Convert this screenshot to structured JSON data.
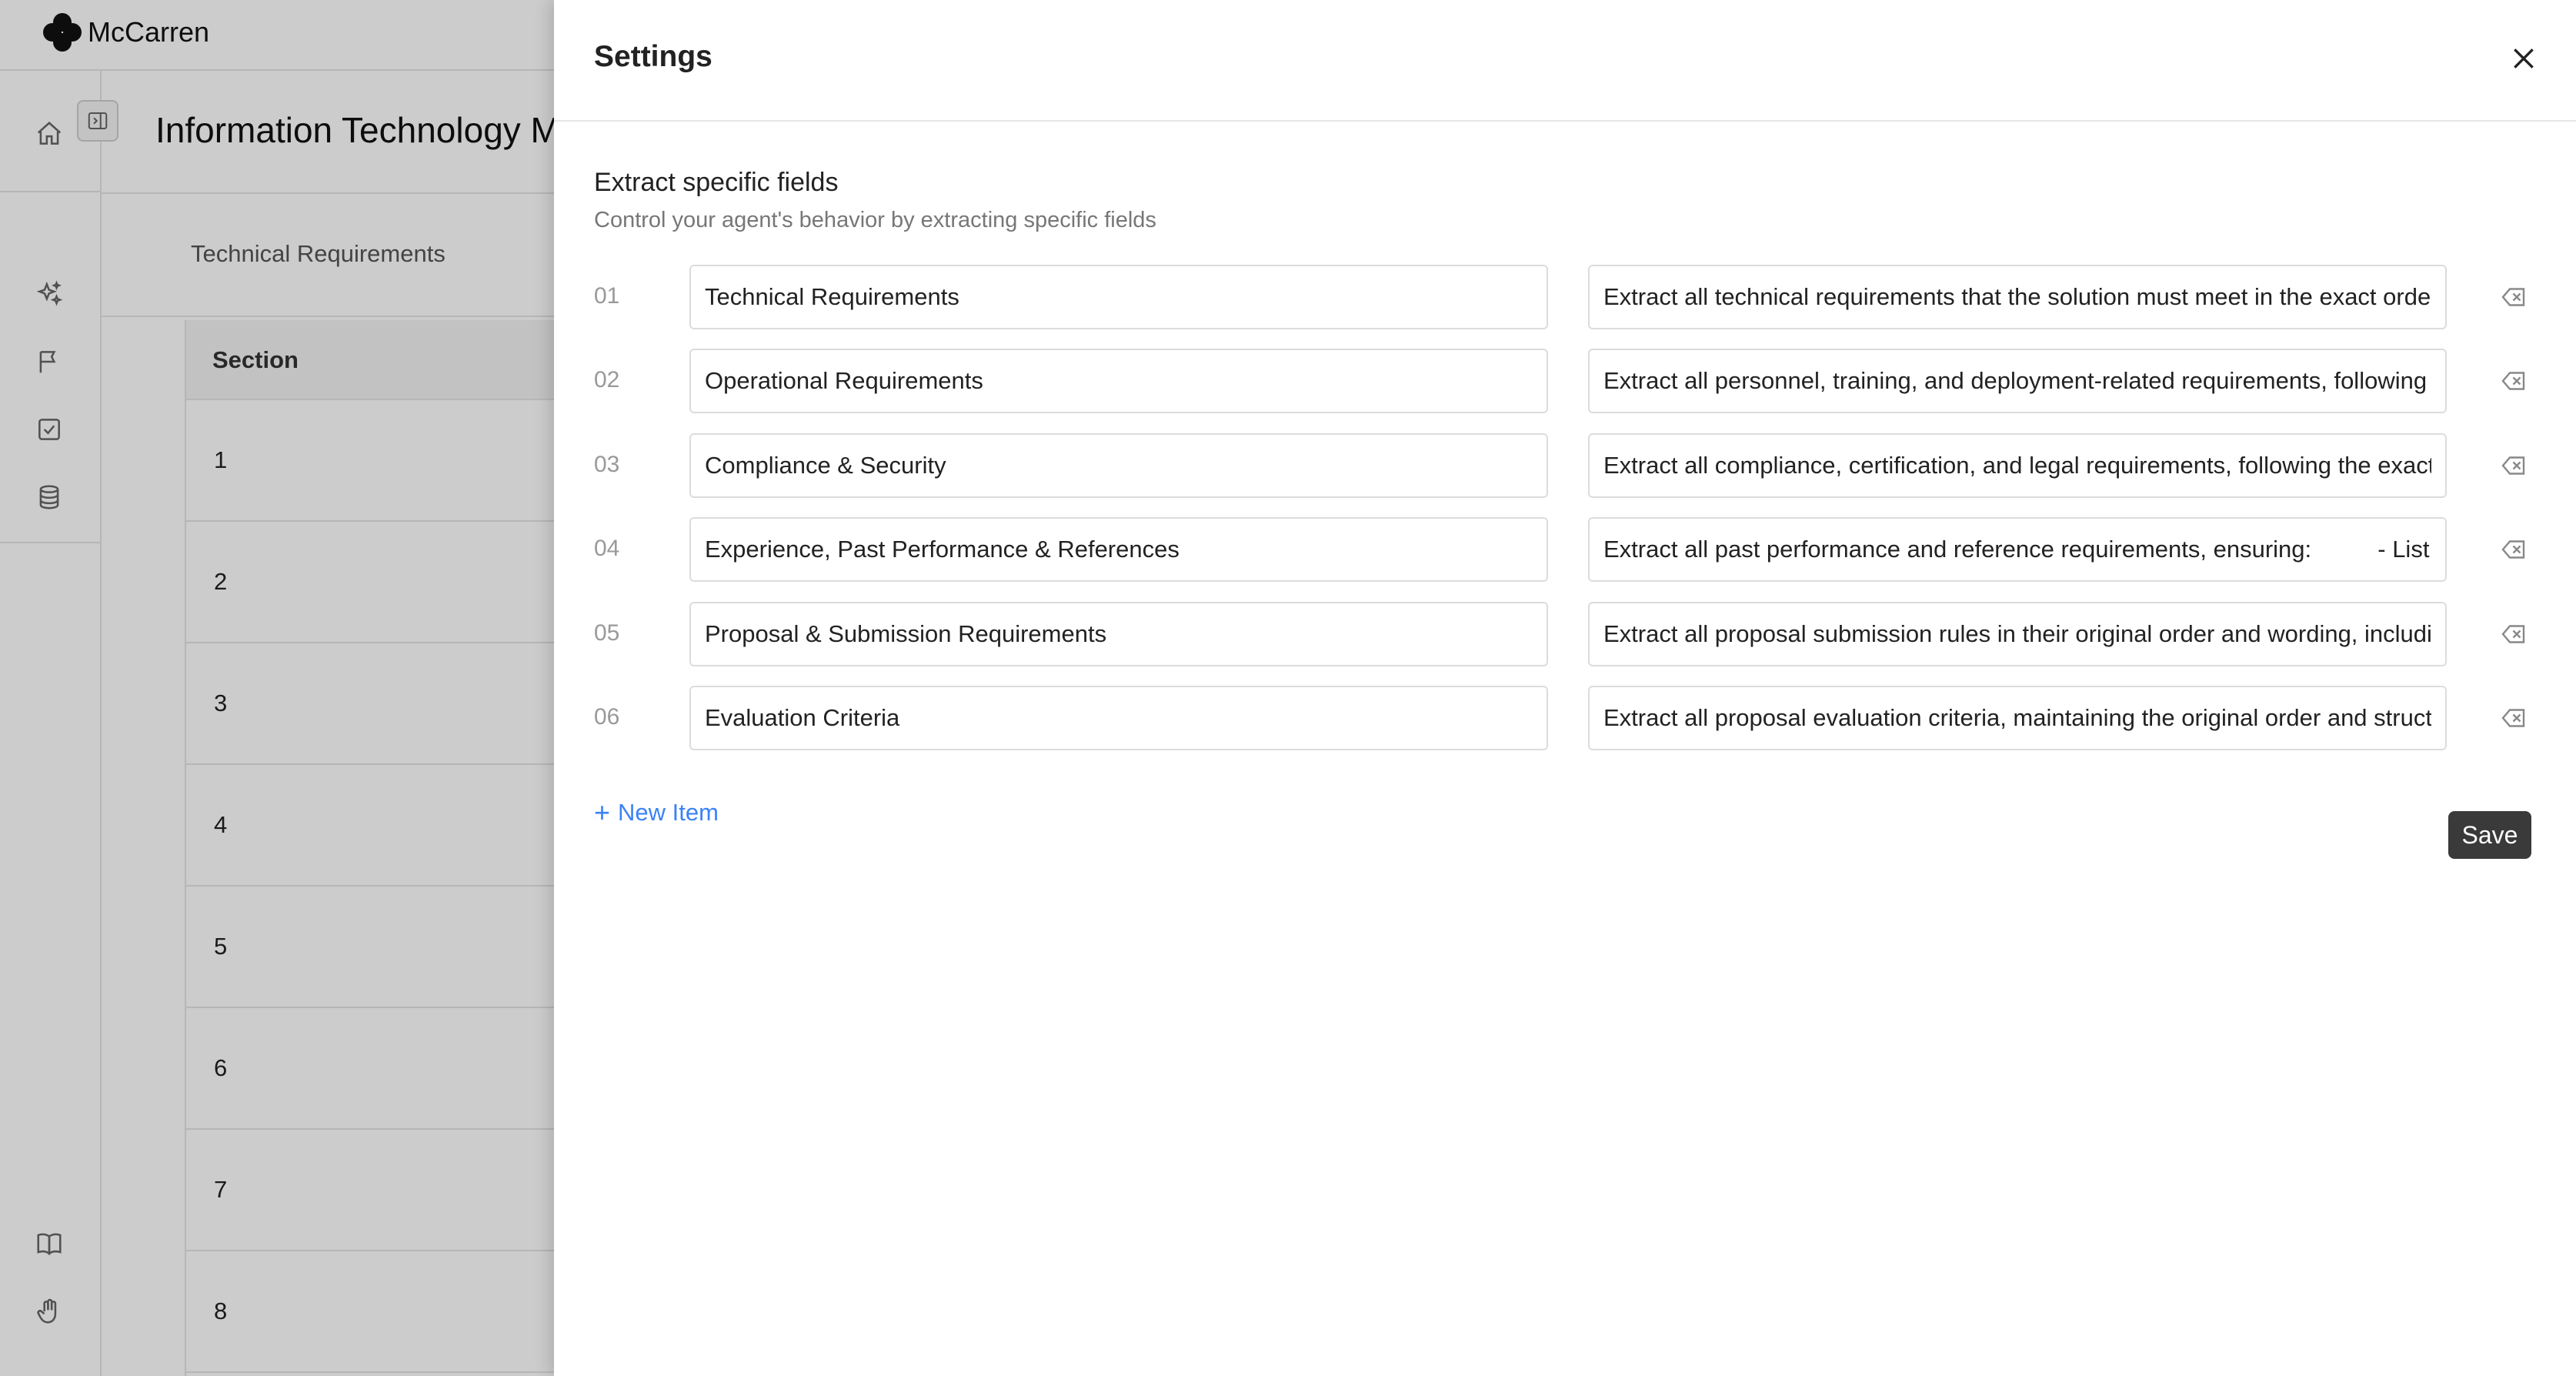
{
  "app": {
    "brand": "McCarren",
    "document_title": "Information Technology Ma",
    "tab_label": "Technical Requirements",
    "table": {
      "column_header": "Section",
      "rows": [
        "1",
        "2",
        "3",
        "4",
        "5",
        "6",
        "7",
        "8"
      ]
    },
    "rail_icons": [
      "home-icon",
      "sparkles-icon",
      "flag-icon",
      "checkbox-icon",
      "database-icon",
      "book-icon",
      "hand-icon"
    ]
  },
  "settings": {
    "title": "Settings",
    "section_title": "Extract specific fields",
    "section_subtitle": "Control your agent's behavior by extracting specific fields",
    "fields": [
      {
        "num": "01",
        "name": "Technical Requirements",
        "desc": "Extract all technical requirements that the solution must meet in the exact order"
      },
      {
        "num": "02",
        "name": "Operational Requirements",
        "desc": "Extract all personnel, training, and deployment-related requirements, following t"
      },
      {
        "num": "03",
        "name": "Compliance & Security",
        "desc": "Extract all compliance, certification, and legal requirements, following the exact"
      },
      {
        "num": "04",
        "name": "Experience, Past Performance & References",
        "desc": "Extract all past performance and reference requirements, ensuring:          - List"
      },
      {
        "num": "05",
        "name": "Proposal & Submission Requirements",
        "desc": "Extract all proposal submission rules in their original order and wording, includir"
      },
      {
        "num": "06",
        "name": "Evaluation Criteria",
        "desc": "Extract all proposal evaluation criteria, maintaining the original order and structu"
      }
    ],
    "new_item_label": "New Item",
    "new_item_plus": "+",
    "save_label": "Save",
    "accent_color": "#3b82f6",
    "save_bg_color": "#3a3a3a"
  }
}
